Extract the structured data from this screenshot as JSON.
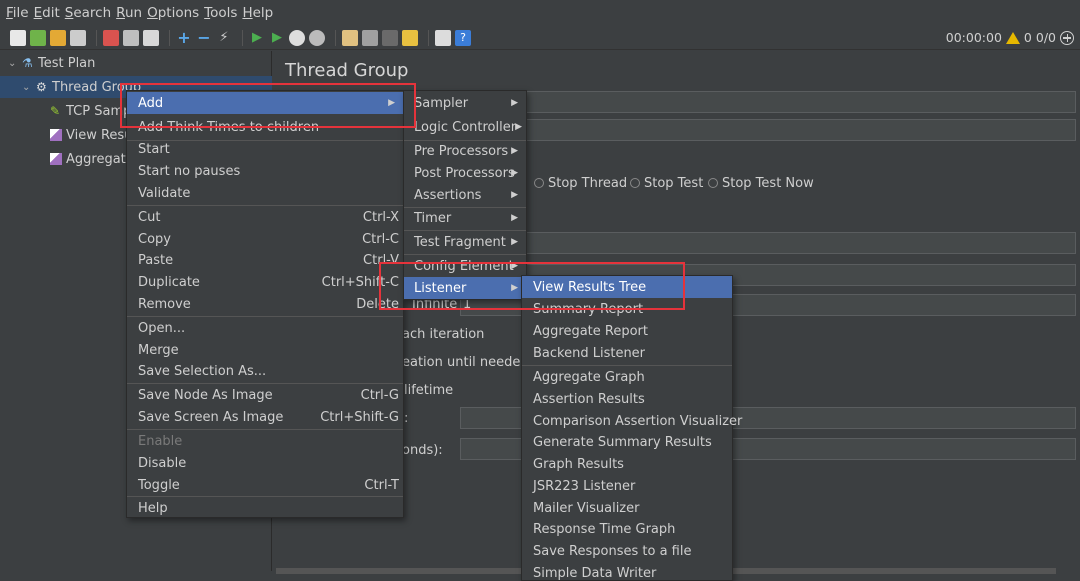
{
  "menubar": [
    "File",
    "Edit",
    "Search",
    "Run",
    "Options",
    "Tools",
    "Help"
  ],
  "status": {
    "timer": "00:00:00",
    "warnings": "0",
    "threads": "0/0"
  },
  "tree": {
    "test_plan": "Test Plan",
    "thread_group": "Thread Group",
    "tcp_sampler": "TCP Samp",
    "view_results": "View Resu",
    "aggregate": "Aggregate"
  },
  "panel": {
    "title": "Thread Group",
    "stop_thread": "Stop Thread",
    "stop_test": "Stop Test",
    "stop_test_now": "Stop Test Now",
    "infinite": "Infinite",
    "loop_value": "1",
    "each_iteration": "ach iteration",
    "creation": "eation until needed",
    "lifetime": "lifetime",
    "seconds": "onds):",
    "colon": ":"
  },
  "context_menu": {
    "add": "Add",
    "add_think_times": "Add Think Times to children",
    "start": "Start",
    "start_no_pauses": "Start no pauses",
    "validate": "Validate",
    "cut": "Cut",
    "cut_sc": "Ctrl-X",
    "copy": "Copy",
    "copy_sc": "Ctrl-C",
    "paste": "Paste",
    "paste_sc": "Ctrl-V",
    "duplicate": "Duplicate",
    "duplicate_sc": "Ctrl+Shift-C",
    "remove": "Remove",
    "remove_sc": "Delete",
    "open": "Open...",
    "merge": "Merge",
    "save_selection": "Save Selection As...",
    "save_node_image": "Save Node As Image",
    "save_node_image_sc": "Ctrl-G",
    "save_screen_image": "Save Screen As Image",
    "save_screen_image_sc": "Ctrl+Shift-G",
    "enable": "Enable",
    "disable": "Disable",
    "toggle": "Toggle",
    "toggle_sc": "Ctrl-T",
    "help": "Help"
  },
  "add_menu": [
    "Sampler",
    "Logic Controller",
    "Pre Processors",
    "Post Processors",
    "Assertions",
    "Timer",
    "Test Fragment",
    "Config Element",
    "Listener"
  ],
  "listener_menu": [
    "View Results Tree",
    "Summary Report",
    "Aggregate Report",
    "Backend Listener",
    "Aggregate Graph",
    "Assertion Results",
    "Comparison Assertion Visualizer",
    "Generate Summary Results",
    "Graph Results",
    "JSR223 Listener",
    "Mailer Visualizer",
    "Response Time Graph",
    "Save Responses to a file",
    "Simple Data Writer"
  ],
  "colors": {
    "highlight": "#4b6eaf",
    "annotation": "#e5333b",
    "background": "#3c3f41"
  }
}
